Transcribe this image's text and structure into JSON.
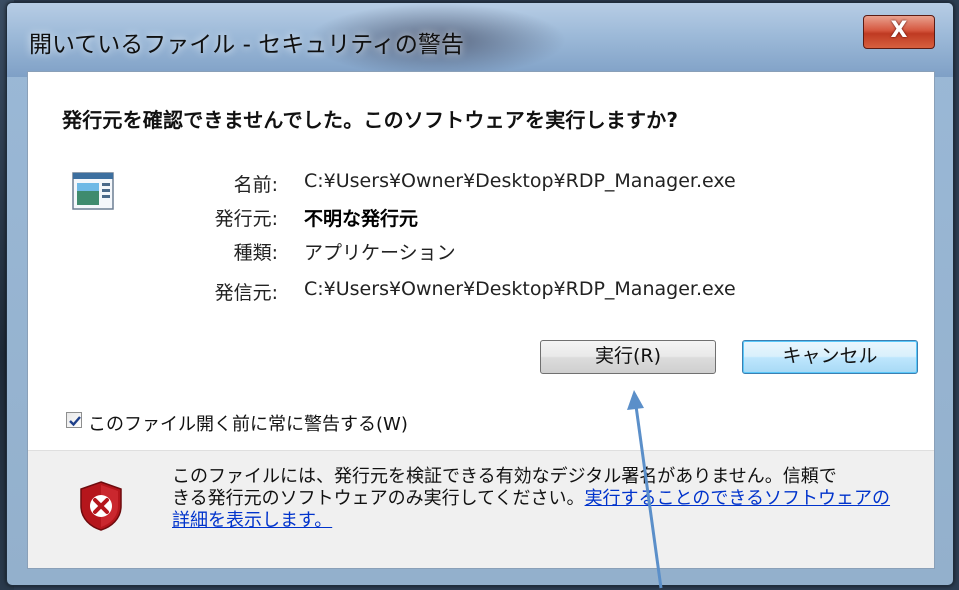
{
  "window": {
    "title": "開いているファイル - セキュリティの警告",
    "close_label": "X"
  },
  "dialog": {
    "question": "発行元を確認できませんでした。このソフトウェアを実行しますか?",
    "fields": [
      {
        "label": "名前:",
        "value": "C:¥Users¥Owner¥Desktop¥RDP_Manager.exe",
        "bold": false
      },
      {
        "label": "発行元:",
        "value": "不明な発行元",
        "bold": true
      },
      {
        "label": "種類:",
        "value": "アプリケーション",
        "bold": false
      },
      {
        "label": "発信元:",
        "value": "C:¥Users¥Owner¥Desktop¥RDP_Manager.exe",
        "bold": false
      }
    ],
    "run_label": "実行(R)",
    "cancel_label": "キャンセル",
    "checkbox_label": "このファイル開く前に常に警告する(W)",
    "checkbox_checked": true,
    "warning_line1": "このファイルには、発行元を検証できる有効なデジタル署名がありません。信頼で",
    "warning_line2_text": "きる発行元のソフトウェアのみ実行してください。",
    "warning_link_part1": "実行することのできるソフトウェアの",
    "warning_link_part2": "詳細を表示します。"
  },
  "icons": {
    "app": "application-icon",
    "shield": "security-shield-icon",
    "arrow": "annotation-arrow"
  },
  "colors": {
    "link": "#0033cc",
    "close_button": "#c8452b",
    "cancel_focus": "#3c7fb1",
    "arrow": "#5b8fc9"
  }
}
